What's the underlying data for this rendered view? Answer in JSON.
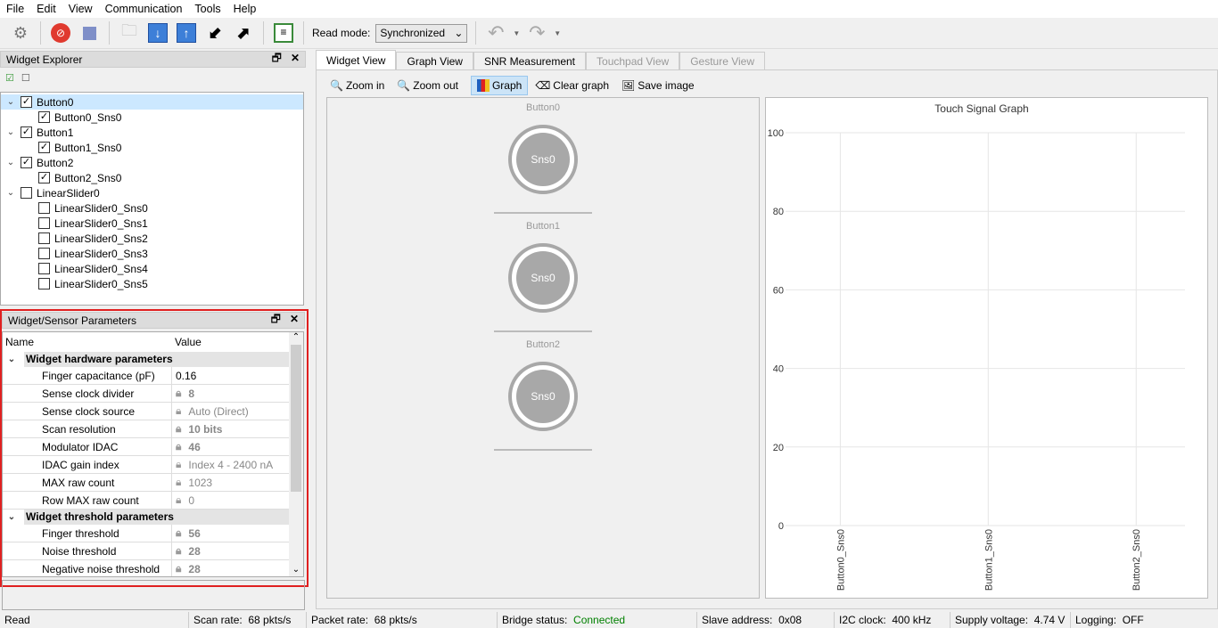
{
  "menu": [
    "File",
    "Edit",
    "View",
    "Communication",
    "Tools",
    "Help"
  ],
  "toolbar": {
    "read_mode_label": "Read mode:",
    "read_mode_value": "Synchronized"
  },
  "explorer": {
    "title": "Widget Explorer",
    "items": [
      {
        "label": "Button0",
        "checked": true,
        "level": 0,
        "expanded": true
      },
      {
        "label": "Button0_Sns0",
        "checked": true,
        "level": 1
      },
      {
        "label": "Button1",
        "checked": true,
        "level": 0,
        "expanded": true
      },
      {
        "label": "Button1_Sns0",
        "checked": true,
        "level": 1
      },
      {
        "label": "Button2",
        "checked": true,
        "level": 0,
        "expanded": true
      },
      {
        "label": "Button2_Sns0",
        "checked": true,
        "level": 1
      },
      {
        "label": "LinearSlider0",
        "checked": false,
        "level": 0,
        "expanded": true
      },
      {
        "label": "LinearSlider0_Sns0",
        "checked": false,
        "level": 1
      },
      {
        "label": "LinearSlider0_Sns1",
        "checked": false,
        "level": 1
      },
      {
        "label": "LinearSlider0_Sns2",
        "checked": false,
        "level": 1
      },
      {
        "label": "LinearSlider0_Sns3",
        "checked": false,
        "level": 1
      },
      {
        "label": "LinearSlider0_Sns4",
        "checked": false,
        "level": 1
      },
      {
        "label": "LinearSlider0_Sns5",
        "checked": false,
        "level": 1
      }
    ]
  },
  "params": {
    "title": "Widget/Sensor Parameters",
    "col_name": "Name",
    "col_value": "Value",
    "groups": [
      {
        "label": "Widget hardware parameters",
        "rows": [
          {
            "name": "Finger capacitance (pF)",
            "value": "0.16",
            "locked": false,
            "bold": false
          },
          {
            "name": "Sense clock divider",
            "value": "8",
            "locked": true,
            "bold": true
          },
          {
            "name": "Sense clock source",
            "value": "Auto (Direct)",
            "locked": true,
            "bold": false
          },
          {
            "name": "Scan resolution",
            "value": "10 bits",
            "locked": true,
            "bold": true
          },
          {
            "name": "Modulator IDAC",
            "value": "46",
            "locked": true,
            "bold": true
          },
          {
            "name": "IDAC gain index",
            "value": "Index 4 - 2400 nA",
            "locked": true,
            "bold": false
          },
          {
            "name": "MAX raw count",
            "value": "1023",
            "locked": true,
            "bold": false
          },
          {
            "name": "Row MAX raw count",
            "value": "0",
            "locked": true,
            "bold": false
          }
        ]
      },
      {
        "label": "Widget threshold parameters",
        "rows": [
          {
            "name": "Finger threshold",
            "value": "56",
            "locked": true,
            "bold": true
          },
          {
            "name": "Noise threshold",
            "value": "28",
            "locked": true,
            "bold": true
          },
          {
            "name": "Negative noise threshold",
            "value": "28",
            "locked": true,
            "bold": true
          }
        ]
      }
    ]
  },
  "tabs": [
    {
      "label": "Widget View",
      "active": true
    },
    {
      "label": "Graph View"
    },
    {
      "label": "SNR Measurement"
    },
    {
      "label": "Touchpad View",
      "disabled": true
    },
    {
      "label": "Gesture View",
      "disabled": true
    }
  ],
  "graph_toolbar": {
    "zoom_in": "Zoom in",
    "zoom_out": "Zoom out",
    "graph": "Graph",
    "clear": "Clear graph",
    "save": "Save image"
  },
  "widgets": [
    {
      "name": "Button0",
      "sensor": "Sns0"
    },
    {
      "name": "Button1",
      "sensor": "Sns0"
    },
    {
      "name": "Button2",
      "sensor": "Sns0"
    }
  ],
  "chart_data": {
    "type": "bar",
    "title": "Touch Signal Graph",
    "categories": [
      "Button0_Sns0",
      "Button1_Sns0",
      "Button2_Sns0"
    ],
    "values": [
      0,
      0,
      0
    ],
    "ylim": [
      0,
      100
    ],
    "yticks": [
      0,
      20,
      40,
      60,
      80,
      100
    ],
    "grid": true
  },
  "status": {
    "state": "Read",
    "scan_rate_label": "Scan rate:",
    "scan_rate": "68 pkts/s",
    "packet_rate_label": "Packet rate:",
    "packet_rate": "68 pkts/s",
    "bridge_label": "Bridge status:",
    "bridge": "Connected",
    "slave_label": "Slave address:",
    "slave": "0x08",
    "i2c_label": "I2C clock:",
    "i2c": "400 kHz",
    "supply_label": "Supply voltage:",
    "supply": "4.74 V",
    "logging_label": "Logging:",
    "logging": "OFF",
    "connected_color": "#008000"
  }
}
